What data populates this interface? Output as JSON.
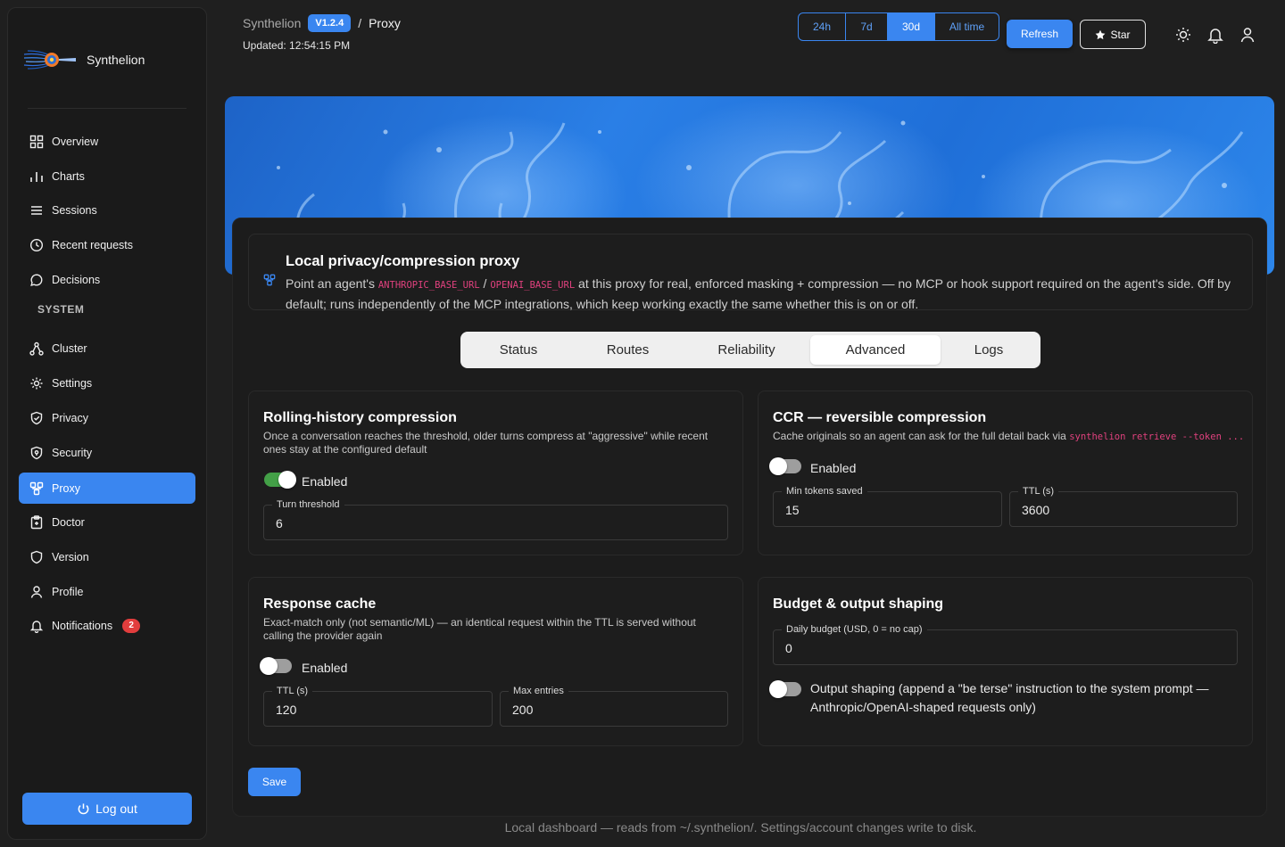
{
  "app": {
    "name": "Synthelion",
    "version": "V1.2.4",
    "page": "Proxy",
    "updated": "Updated: 12:54:15 PM"
  },
  "sidebar": {
    "items": [
      {
        "label": "Overview"
      },
      {
        "label": "Charts"
      },
      {
        "label": "Sessions"
      },
      {
        "label": "Recent requests"
      },
      {
        "label": "Decisions"
      }
    ],
    "section": "SYSTEM",
    "system_items": [
      {
        "label": "Cluster"
      },
      {
        "label": "Settings"
      },
      {
        "label": "Privacy"
      },
      {
        "label": "Security"
      },
      {
        "label": "Proxy"
      },
      {
        "label": "Doctor"
      },
      {
        "label": "Version"
      },
      {
        "label": "Profile"
      },
      {
        "label": "Notifications"
      }
    ],
    "notification_count": "2",
    "logout": "Log out"
  },
  "header": {
    "ranges": [
      {
        "label": "24h"
      },
      {
        "label": "7d"
      },
      {
        "label": "30d"
      },
      {
        "label": "All time"
      }
    ],
    "active_range": "30d",
    "refresh": "Refresh",
    "star": "Star"
  },
  "intro": {
    "title": "Local privacy/compression proxy",
    "text_a": "Point an agent's ",
    "code_a": "ANTHROPIC_BASE_URL",
    "text_b": " / ",
    "code_b": "OPENAI_BASE_URL",
    "text_c": " at this proxy for real, enforced masking + compression — no MCP or hook support required on the agent's side. Off by default; runs independently of the MCP integrations, which keep working exactly the same whether this is on or off."
  },
  "tabs": [
    {
      "label": "Status"
    },
    {
      "label": "Routes"
    },
    {
      "label": "Reliability"
    },
    {
      "label": "Advanced"
    },
    {
      "label": "Logs"
    }
  ],
  "active_tab": "Advanced",
  "cards": {
    "rolling": {
      "title": "Rolling-history compression",
      "desc": "Once a conversation reaches the threshold, older turns compress at \"aggressive\" while recent ones stay at the configured default",
      "toggle_label": "Enabled",
      "enabled": true,
      "threshold_label": "Turn threshold",
      "threshold_value": "6"
    },
    "ccr": {
      "title": "CCR — reversible compression",
      "desc": "Cache originals so an agent can ask for the full detail back via ",
      "desc_code": "synthelion retrieve --token ...",
      "toggle_label": "Enabled",
      "enabled": false,
      "min_tokens_label": "Min tokens saved",
      "min_tokens_value": "15",
      "ttl_label": "TTL (s)",
      "ttl_value": "3600"
    },
    "cache": {
      "title": "Response cache",
      "desc": "Exact-match only (not semantic/ML) — an identical request within the TTL is served without calling the provider again",
      "toggle_label": "Enabled",
      "enabled": false,
      "ttl_label": "TTL (s)",
      "ttl_value": "120",
      "max_label": "Max entries",
      "max_value": "200"
    },
    "budget": {
      "title": "Budget & output shaping",
      "budget_label": "Daily budget (USD, 0 = no cap)",
      "budget_value": "0",
      "shaping_label": "Output shaping (append a \"be terse\" instruction to the system prompt — Anthropic/OpenAI-shaped requests only)",
      "shaping_enabled": false
    }
  },
  "save": "Save",
  "footer": "Local dashboard — reads from ~/.synthelion/. Settings/account changes write to disk.",
  "colors": {
    "accent": "#3a86f0",
    "toggle_on": "#43a047",
    "code": "#e0417e",
    "badge": "#e23d3d"
  }
}
